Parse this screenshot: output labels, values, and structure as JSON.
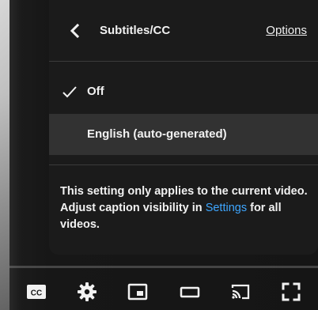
{
  "menu": {
    "title": "Subtitles/CC",
    "options_label": "Options",
    "items": [
      {
        "label": "Off",
        "selected": true
      },
      {
        "label": "English (auto-generated)",
        "selected": false
      }
    ],
    "info": {
      "text_before": "This setting only applies to the current video. Adjust caption visibility in ",
      "link_label": "Settings",
      "text_after": " for all videos."
    }
  },
  "controls": {
    "icons": [
      "subtitles-icon",
      "settings-gear-icon",
      "miniplayer-icon",
      "theater-mode-icon",
      "cast-icon",
      "fullscreen-icon"
    ]
  },
  "colors": {
    "link": "#3ea6ff",
    "menu_bg": "#1c1c1c",
    "text": "#f1f1f1"
  }
}
